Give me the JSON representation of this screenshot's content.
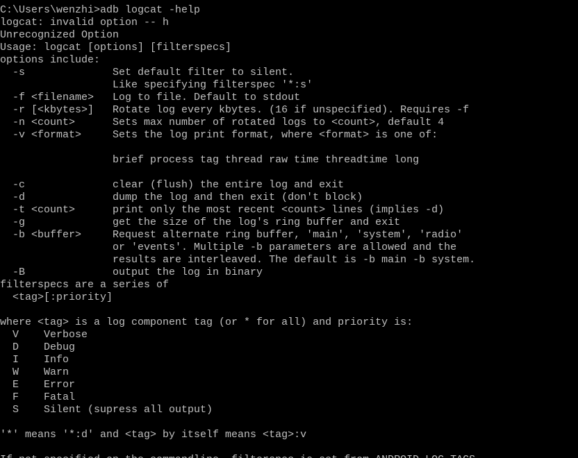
{
  "terminal": {
    "colors": {
      "background": "#000000",
      "text": "#c0c0c0"
    },
    "lines": [
      "C:\\Users\\wenzhi>adb logcat -help",
      "logcat: invalid option -- h",
      "Unrecognized Option",
      "Usage: logcat [options] [filterspecs]",
      "options include:",
      "  -s              Set default filter to silent.",
      "                  Like specifying filterspec '*:s'",
      "  -f <filename>   Log to file. Default to stdout",
      "  -r [<kbytes>]   Rotate log every kbytes. (16 if unspecified). Requires -f",
      "  -n <count>      Sets max number of rotated logs to <count>, default 4",
      "  -v <format>     Sets the log print format, where <format> is one of:",
      "",
      "                  brief process tag thread raw time threadtime long",
      "",
      "  -c              clear (flush) the entire log and exit",
      "  -d              dump the log and then exit (don't block)",
      "  -t <count>      print only the most recent <count> lines (implies -d)",
      "  -g              get the size of the log's ring buffer and exit",
      "  -b <buffer>     Request alternate ring buffer, 'main', 'system', 'radio'",
      "                  or 'events'. Multiple -b parameters are allowed and the",
      "                  results are interleaved. The default is -b main -b system.",
      "  -B              output the log in binary",
      "filterspecs are a series of",
      "  <tag>[:priority]",
      "",
      "where <tag> is a log component tag (or * for all) and priority is:",
      "  V    Verbose",
      "  D    Debug",
      "  I    Info",
      "  W    Warn",
      "  E    Error",
      "  F    Fatal",
      "  S    Silent (supress all output)",
      "",
      "'*' means '*:d' and <tag> by itself means <tag>:v",
      "",
      "If not specified on the commandline, filterspec is set from ANDROID_LOG_TAGS"
    ]
  }
}
